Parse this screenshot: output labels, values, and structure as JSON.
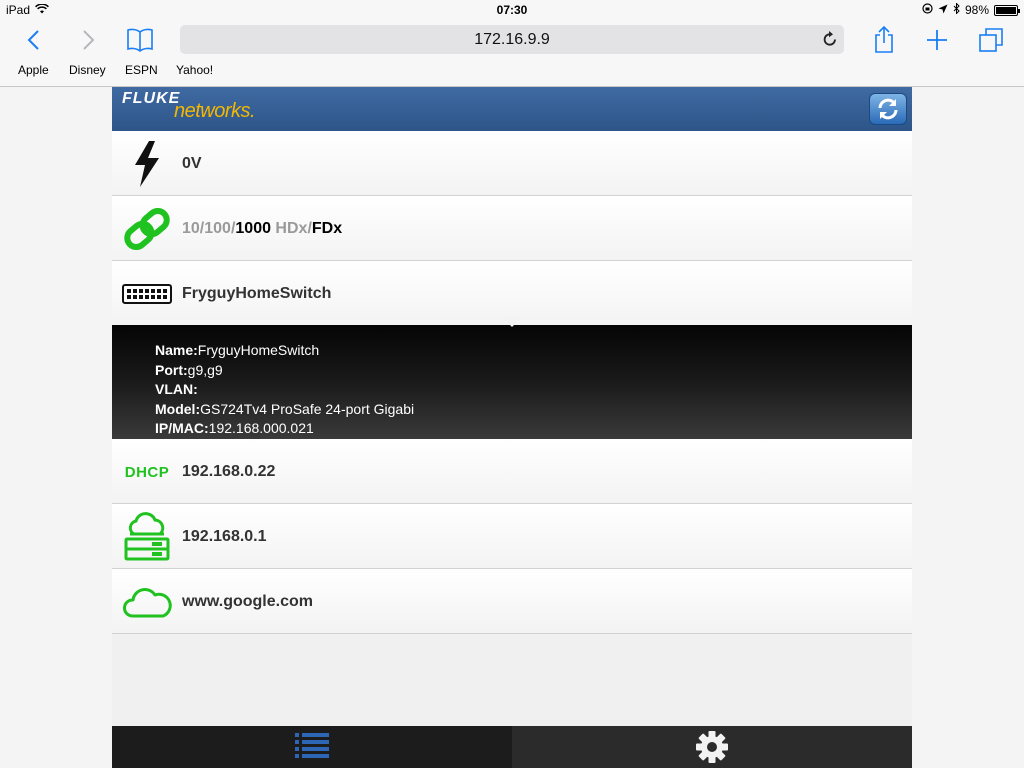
{
  "status_bar": {
    "device": "iPad",
    "time": "07:30",
    "battery": "98%",
    "battery_level": 0.98
  },
  "browser": {
    "url": "172.16.9.9",
    "bookmarks": [
      "Apple",
      "Disney",
      "ESPN",
      "Yahoo!"
    ],
    "icons": {
      "back": "chevron-left-icon",
      "forward": "chevron-right-icon",
      "bookmarks": "book-icon",
      "reload": "reload-icon",
      "share": "share-icon",
      "new_tab": "plus-icon",
      "tabs": "tabs-icon"
    },
    "accent_color": "#1a7ef5"
  },
  "app": {
    "logo_top": "FLUKE",
    "logo_bottom": "networks.",
    "header_color": "#305a8f",
    "rows": {
      "voltage": "0V",
      "link": {
        "speed_10": "10/",
        "speed_100": "100/",
        "speed_1000": "1000",
        "duplex_half": " HDx/",
        "duplex_full": "FDx"
      },
      "switch": "FryguyHomeSwitch",
      "dhcp_label": "DHCP",
      "dhcp": "192.168.0.22",
      "gateway": "192.168.0.1",
      "dns": "www.google.com"
    },
    "detail": {
      "name_label": "Name:",
      "name_value": "FryguyHomeSwitch",
      "port_label": "Port:",
      "port_value": "g9,g9",
      "vlan_label": "VLAN:",
      "vlan_value": "",
      "model_label": "Model:",
      "model_value": "GS724Tv4 ProSafe 24-port Gigabi",
      "ipmac_label": "IP/MAC:",
      "ipmac_value": "192.168.000.021"
    },
    "status_color": "#1fc21f",
    "tabs": {
      "list_icon": "list-icon",
      "settings_icon": "gear-icon",
      "list_color": "#2d66b5"
    }
  }
}
